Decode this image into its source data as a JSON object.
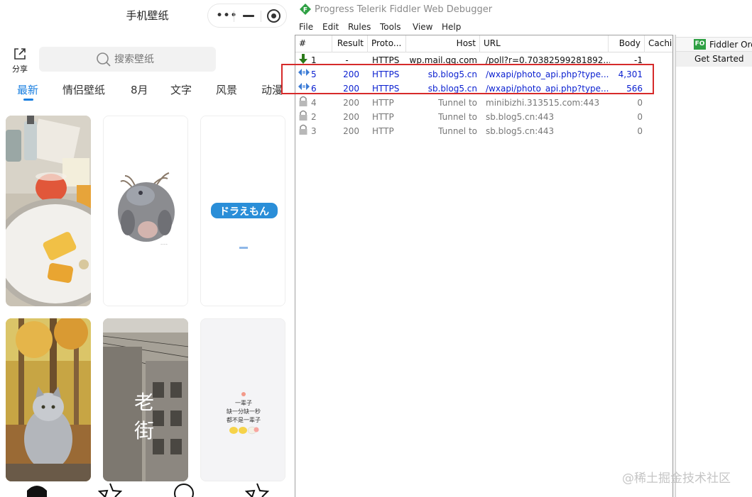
{
  "mini_program": {
    "title": "手机壁纸",
    "share_label": "分享",
    "search_placeholder": "搜索壁纸",
    "tabs": [
      {
        "label": "最新",
        "active": true
      },
      {
        "label": "情侣壁纸",
        "active": false
      },
      {
        "label": "8月",
        "active": false
      },
      {
        "label": "文字",
        "active": false
      },
      {
        "label": "风景",
        "active": false
      },
      {
        "label": "动漫",
        "active": false
      }
    ],
    "accent_color": "#1a7fe0",
    "cards": [
      {
        "name": "breakfast-photo",
        "text": ""
      },
      {
        "name": "monster-illustration",
        "text": ""
      },
      {
        "name": "doraemon-logo",
        "text": "ドラえもん"
      },
      {
        "name": "cat-autumn-photo",
        "text": ""
      },
      {
        "name": "old-street-photo",
        "text": "老街"
      },
      {
        "name": "text-quote-card",
        "text": "一辈子\n缺一分缺一秒\n都不是一辈子"
      }
    ],
    "bottom_nav": [
      "home-icon",
      "star-outline-icon",
      "circle-icon",
      "star-icon"
    ]
  },
  "fiddler": {
    "title": "Progress Telerik Fiddler Web Debugger",
    "menu": [
      "File",
      "Edit",
      "Rules",
      "Tools",
      "View",
      "Help"
    ],
    "columns": [
      "#",
      "Result",
      "Proto...",
      "Host",
      "URL",
      "Body",
      "Cachi"
    ],
    "sessions": [
      {
        "num": "1",
        "result": "-",
        "protocol": "HTTPS",
        "host": "wp.mail.qq.com",
        "url": "/poll?r=0.70382599281892...",
        "body": "-1",
        "icon": "download-arrow-icon",
        "color": "#111111"
      },
      {
        "num": "5",
        "result": "200",
        "protocol": "HTTPS",
        "host": "sb.blog5.cn",
        "url": "/wxapi/photo_api.php?type...",
        "body": "4,301",
        "icon": "json-icon",
        "color": "#0a1fd0"
      },
      {
        "num": "6",
        "result": "200",
        "protocol": "HTTPS",
        "host": "sb.blog5.cn",
        "url": "/wxapi/photo_api.php?type...",
        "body": "566",
        "icon": "json-icon",
        "color": "#0a1fd0"
      },
      {
        "num": "4",
        "result": "200",
        "protocol": "HTTP",
        "host": "Tunnel to",
        "url": "minibizhi.313515.com:443",
        "body": "0",
        "icon": "lock-icon",
        "color": "#777777"
      },
      {
        "num": "2",
        "result": "200",
        "protocol": "HTTP",
        "host": "Tunnel to",
        "url": "sb.blog5.cn:443",
        "body": "0",
        "icon": "lock-icon",
        "color": "#777777"
      },
      {
        "num": "3",
        "result": "200",
        "protocol": "HTTP",
        "host": "Tunnel to",
        "url": "sb.blog5.cn:443",
        "body": "0",
        "icon": "lock-icon",
        "color": "#777777"
      }
    ],
    "right_tabs": {
      "orchestra_badge": "FO",
      "orchestra_label": "Fiddler Orc",
      "get_started": "Get Started"
    },
    "highlight_color": "#d62a2a"
  },
  "watermark": "@稀土掘金技术社区"
}
